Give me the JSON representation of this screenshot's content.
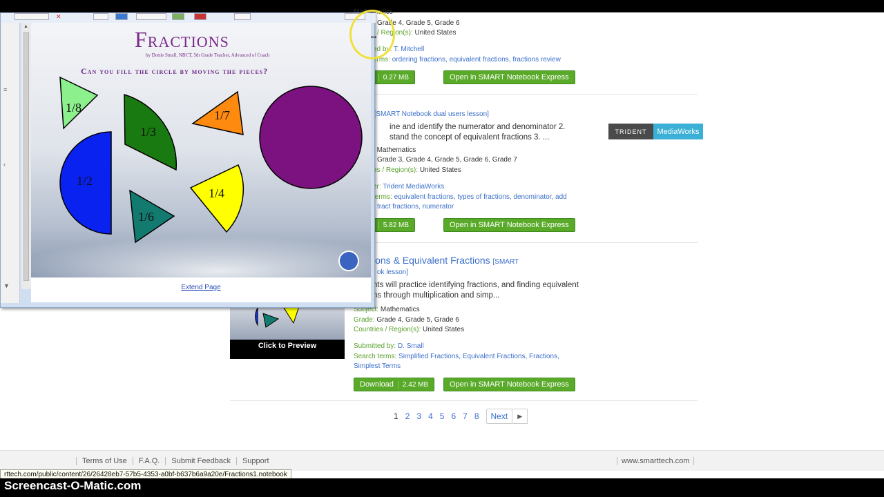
{
  "results": [
    {
      "grades": "Grade 4,  Grade 5,  Grade 6",
      "countries_label": "/ Region(s):",
      "countries": "United States",
      "submitted_label": "ed by:",
      "submitted": "T. Mitchell",
      "terms_label": "erms:",
      "terms": "ordering fractions,  equivalent fractions,  fractions review",
      "download_label": "load",
      "size": "0.27 MB",
      "open_label": "Open in SMART Notebook Express",
      "top_label": "Mathematics"
    },
    {
      "title": "ions",
      "title_tag": "[SMART Notebook dual users lesson]",
      "desc1": "ine and identify the numerator and denominator 2.",
      "desc2": "stand the concept of equivalent fractions 3. ...",
      "subject_label": ":",
      "subject": "Mathematics",
      "grades": "Grade 3,  Grade 4,  Grade 5,  Grade 6,  Grade 7",
      "countries_label": "es / Region(s):",
      "countries": "United States",
      "publisher_label": "er:",
      "publisher": "Trident MediaWorks",
      "terms_label": "terms:",
      "terms1": "equivalent fractions,  types of fractions,  denominator,  add",
      "terms2": "tract fractions,  numerator",
      "download_label": "load",
      "size": "5.82 MB",
      "open_label": "Open in SMART Notebook Express",
      "logo_left": "TRIDENT",
      "logo_right": "MediaWorks"
    },
    {
      "title": "ions & Equivalent Fractions",
      "title_tag": "[SMART",
      "title_tag2": "ok lesson]",
      "desc1": "nts will practice identifying fractions, and finding equivalent",
      "desc2": "ns through multiplication and simp...",
      "subject_label": "Subject:",
      "subject": "Mathematics",
      "grade_label": "Grade:",
      "grades": "Grade 4,  Grade 5,  Grade 6",
      "countries_label": "Countries / Region(s):",
      "countries": "United States",
      "submitted_label": "Submitted by:",
      "submitted": "D. Small",
      "terms_label": "Search terms:",
      "terms1": "Simplified Fractions,  Equivalent Fractions,  Fractions,",
      "terms2": "Simplest Terms",
      "download_label": "Download",
      "size": "2.42 MB",
      "open_label": "Open in SMART Notebook Express",
      "preview_caption": "Click to Preview"
    }
  ],
  "pagination": {
    "current": "1",
    "pages": [
      "2",
      "3",
      "4",
      "5",
      "6",
      "7",
      "8"
    ],
    "next": "Next"
  },
  "footer": {
    "links": [
      "Terms of Use",
      "F.A.Q.",
      "Submit Feedback",
      "Support"
    ],
    "site": "www.smarttech.com"
  },
  "status_url": "rttech.com/public/content/26/26428eb7-57b5-4353-a0bf-b637b6a9a20e/Fractions1.notebook",
  "watermark": "Screencast-O-Matic.com",
  "notebook": {
    "title": "Fractions",
    "byline": "by Dottie Small, NBCT, 5th Grade Teacher, Advanced of Coach",
    "question": "Can you fill the circle by moving the pieces?",
    "pieces": [
      "1/8",
      "1/3",
      "1/7",
      "1/2",
      "1/4",
      "1/6"
    ],
    "extend_label": "Extend Page"
  },
  "colors": {
    "accent_green": "#5aaa2a",
    "link_blue": "#3b6fc9",
    "label_green": "#5aa02c",
    "purple_circle": "#7b127f"
  }
}
